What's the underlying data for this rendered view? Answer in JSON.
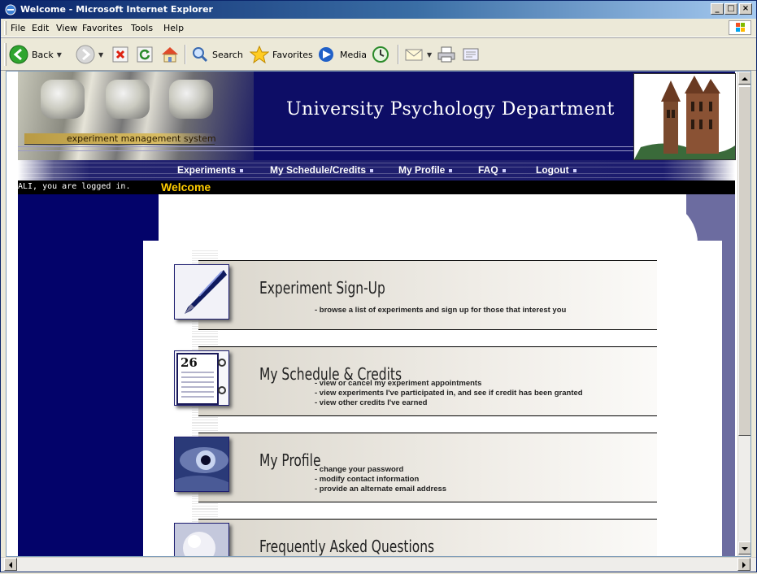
{
  "window": {
    "title": "Welcome - Microsoft Internet Explorer",
    "buttons": {
      "minimize": "_",
      "maximize": "□",
      "close": "×"
    }
  },
  "menu": [
    "File",
    "Edit",
    "View",
    "Favorites",
    "Tools",
    "Help"
  ],
  "toolbar": {
    "back": "Back",
    "search": "Search",
    "favorites": "Favorites",
    "media": "Media"
  },
  "banner": {
    "subtitle": "experiment management system",
    "title": "University Psychology Department"
  },
  "nav": [
    "Experiments",
    "My Schedule/Credits",
    "My Profile",
    "FAQ",
    "Logout"
  ],
  "status": {
    "login": "ALI, you are logged in.",
    "page_title": "Welcome"
  },
  "sections": [
    {
      "title": "Experiment Sign-Up",
      "icon": "pen-icon",
      "lines": [
        "- browse a list of experiments and sign up for those that interest you"
      ]
    },
    {
      "title": "My Schedule & Credits",
      "icon": "calendar-icon",
      "calendar_day": "26",
      "lines": [
        "- view or cancel my experiment appointments",
        "- view experiments I've participated in, and see if credit has been granted",
        "- view other credits I've earned"
      ]
    },
    {
      "title": "My Profile",
      "icon": "eye-icon",
      "lines": [
        "- change your password",
        "- modify contact information",
        "- provide an alternate email address"
      ]
    },
    {
      "title": "Frequently Asked Questions",
      "icon": "lightbulb-icon",
      "lines": []
    }
  ],
  "colors": {
    "banner": "#0d0d66",
    "left_column": "#03036a",
    "welcome_text": "#ffcc00",
    "right_column": "#6c6ca0"
  }
}
